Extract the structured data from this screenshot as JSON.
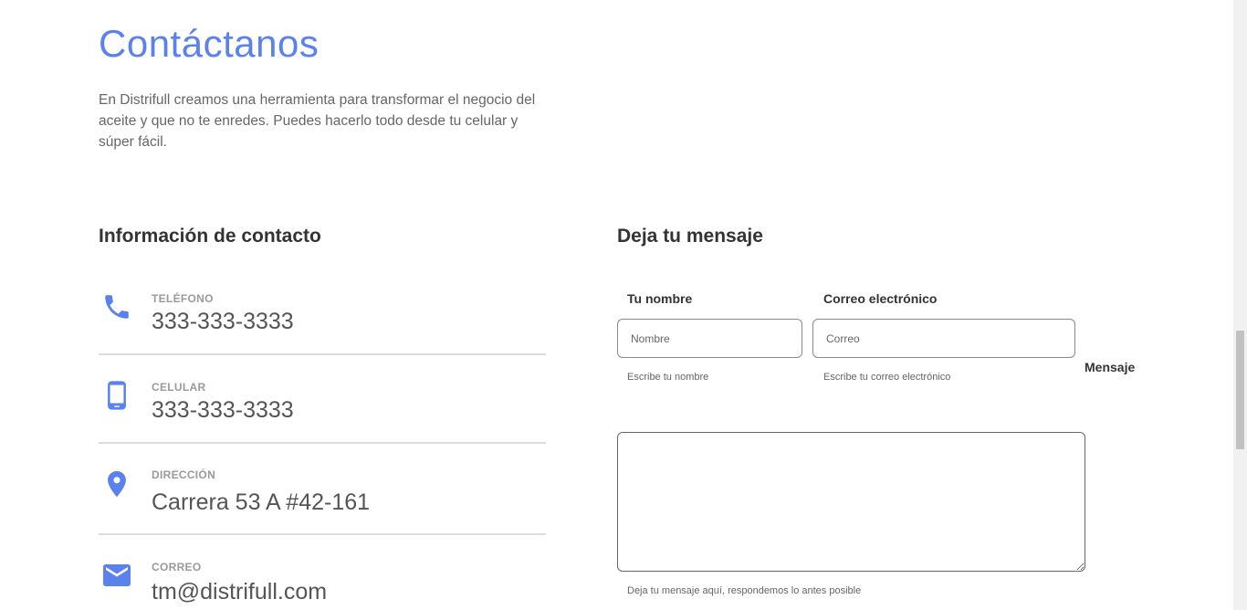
{
  "header": {
    "title": "Contáctanos",
    "intro": "En Distrifull creamos una herramienta para transformar el negocio del aceite y que no te enredes. Puedes hacerlo todo desde tu celular y súper fácil."
  },
  "contact_info": {
    "heading": "Información de contacto",
    "items": [
      {
        "label": "TELÉFONO",
        "value": "333-333-3333",
        "icon": "phone-icon"
      },
      {
        "label": "CELULAR",
        "value": "333-333-3333",
        "icon": "mobile-icon"
      },
      {
        "label": "DIRECCIÓN",
        "value": "Carrera 53 A #42-161",
        "icon": "location-pin-icon"
      },
      {
        "label": "CORREO",
        "value": "tm@distrifull.com",
        "icon": "mail-icon"
      }
    ]
  },
  "form": {
    "heading": "Deja tu mensaje",
    "name": {
      "label": "Tu nombre",
      "placeholder": "Nombre",
      "value": "",
      "helper": "Escribe tu nombre"
    },
    "email": {
      "label": "Correo electrónico",
      "placeholder": "Correo",
      "value": "",
      "helper": "Escribe tu correo electrónico"
    },
    "message": {
      "label": "Mensaje",
      "value": "",
      "helper": "Deja tu mensaje aquí, respondemos lo antes posible"
    }
  },
  "colors": {
    "accent": "#5b82ec",
    "text": "#333333",
    "muted": "#9a9a9a",
    "divider": "#dcdcdc"
  }
}
